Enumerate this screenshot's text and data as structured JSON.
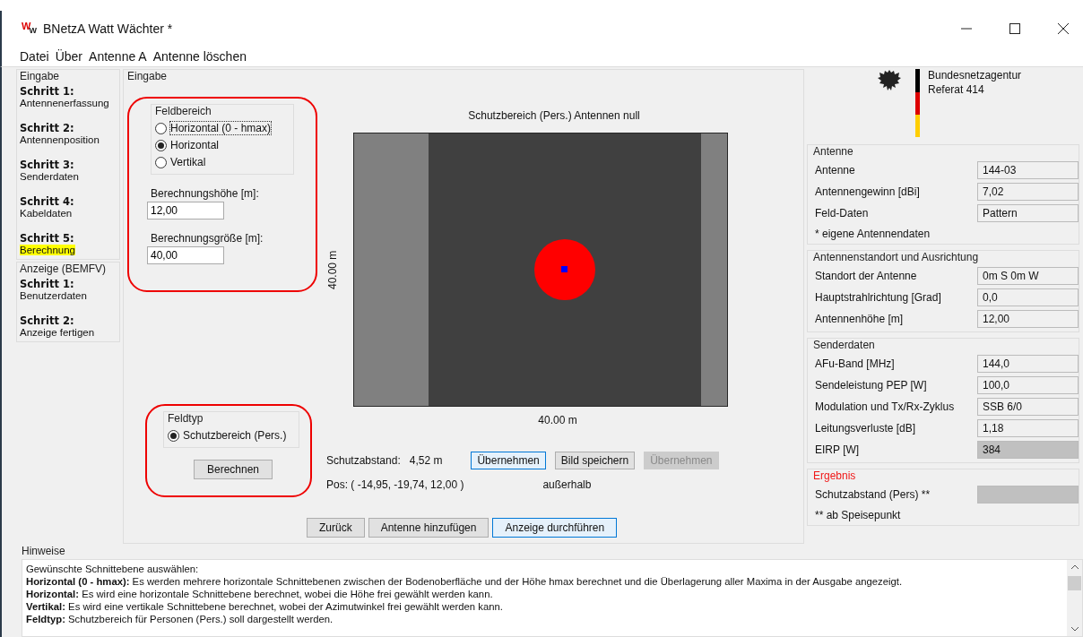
{
  "window": {
    "icon_letters": [
      "W",
      "W"
    ],
    "title": "BNetzA Watt Wächter *"
  },
  "menu": [
    "Datei",
    "Über",
    "Antenne A",
    "Antenne löschen"
  ],
  "nav": [
    {
      "title": "Eingabe",
      "steps": [
        {
          "step": "Schritt 1:",
          "label": "Antennenerfassung",
          "selected": false
        },
        {
          "step": "Schritt 2:",
          "label": "Antennenposition",
          "selected": false
        },
        {
          "step": "Schritt 3:",
          "label": "Senderdaten",
          "selected": false
        },
        {
          "step": "Schritt 4:",
          "label": "Kabeldaten",
          "selected": false
        },
        {
          "step": "Schritt 5:",
          "label": "Berechnung",
          "selected": true
        }
      ]
    },
    {
      "title": "Anzeige (BEMFV)",
      "steps": [
        {
          "step": "Schritt 1:",
          "label": "Benutzerdaten",
          "selected": false
        },
        {
          "step": "Schritt 2:",
          "label": "Anzeige fertigen",
          "selected": false
        }
      ]
    }
  ],
  "eingabe": {
    "title": "Eingabe",
    "feldbereich": {
      "title": "Feldbereich",
      "options": [
        {
          "label": "Horizontal (0 - hmax)",
          "selected": false,
          "focused": true
        },
        {
          "label": "Horizontal",
          "selected": true,
          "focused": false
        },
        {
          "label": "Vertikal",
          "selected": false,
          "focused": false
        }
      ]
    },
    "inputs": [
      {
        "label": "Berechnungshöhe [m]:",
        "value": "12,00"
      },
      {
        "label": "Berechnungsgröße [m]:",
        "value": "40,00"
      }
    ],
    "feldtyp": {
      "title": "Feldtyp",
      "options": [
        {
          "label": "Schutzbereich (Pers.)",
          "selected": true
        }
      ]
    },
    "calc_button": "Berechnen",
    "plot": {
      "title": "Schutzbereich (Pers.) Antennen null",
      "y_label": "40.00 m",
      "x_label": "40.00 m"
    },
    "distance": {
      "label": "Schutzabstand:",
      "value": "4,52 m"
    },
    "actions": [
      {
        "label": "Übernehmen",
        "highlighted": true,
        "disabled": false
      },
      {
        "label": "Bild speichern",
        "highlighted": false,
        "disabled": false
      },
      {
        "label": "Übernehmen",
        "highlighted": false,
        "disabled": true
      }
    ],
    "pos": "Pos: ( -14,95, -19,74, 12,00 )",
    "position_status": "außerhalb",
    "nav_buttons": [
      {
        "label": "Zurück",
        "highlighted": false
      },
      {
        "label": "Antenne hinzufügen",
        "highlighted": false
      },
      {
        "label": "Anzeige durchführen",
        "highlighted": true
      }
    ]
  },
  "agency": {
    "name": "Bundesnetzagentur",
    "unit": "Referat 414"
  },
  "sections": [
    {
      "title": "Antenne",
      "alert": false,
      "fields": [
        {
          "label": "Antenne",
          "value": "144-03",
          "disabled": false
        },
        {
          "label": "Antennengewinn [dBi]",
          "value": "7,02",
          "disabled": false
        },
        {
          "label": "Feld-Daten",
          "value": "Pattern",
          "disabled": false
        }
      ],
      "note": "* eigene Antennendaten"
    },
    {
      "title": "Antennenstandort und Ausrichtung",
      "alert": false,
      "fields": [
        {
          "label": "Standort der Antenne",
          "value": "0m S 0m W",
          "disabled": false
        },
        {
          "label": "Hauptstrahlrichtung [Grad]",
          "value": "0,0",
          "disabled": false
        },
        {
          "label": "Antennenhöhe [m]",
          "value": "12,00",
          "disabled": false
        }
      ]
    },
    {
      "title": "Senderdaten",
      "alert": false,
      "fields": [
        {
          "label": "AFu-Band [MHz]",
          "value": "144,0",
          "disabled": false
        },
        {
          "label": "Sendeleistung PEP [W]",
          "value": "100,0",
          "disabled": false
        },
        {
          "label": "Modulation und Tx/Rx-Zyklus",
          "value": "SSB 6/0",
          "disabled": false
        },
        {
          "label": "Leitungsverluste [dB]",
          "value": "1,18",
          "disabled": false
        },
        {
          "label": "EIRP [W]",
          "value": "384",
          "disabled": true
        }
      ]
    },
    {
      "title": "Ergebnis",
      "alert": true,
      "fields": [
        {
          "label": "Schutzabstand (Pers) **",
          "disabled": true
        }
      ],
      "note": "** ab Speisepunkt"
    }
  ],
  "hints": {
    "title": "Hinweise",
    "lines": [
      "Gewünschte Schnittebene auswählen:",
      "**Horizontal (0 - hmax):** Es werden mehrere horizontale Schnittebenen zwischen der Bodenoberfläche und der Höhe hmax berechnet und die Überlagerung aller Maxima in der Ausgabe angezeigt.",
      "**Horizontal:** Es wird eine horizontale Schnittebene berechnet, wobei die Höhe frei gewählt werden kann.",
      "**Vertikal:** Es wird eine vertikale Schnittebene berechnet, wobei der Azimutwinkel frei gewählt werden kann.",
      "**Feldtyp:** Schutzbereich für Personen (Pers.) soll dargestellt werden."
    ]
  }
}
